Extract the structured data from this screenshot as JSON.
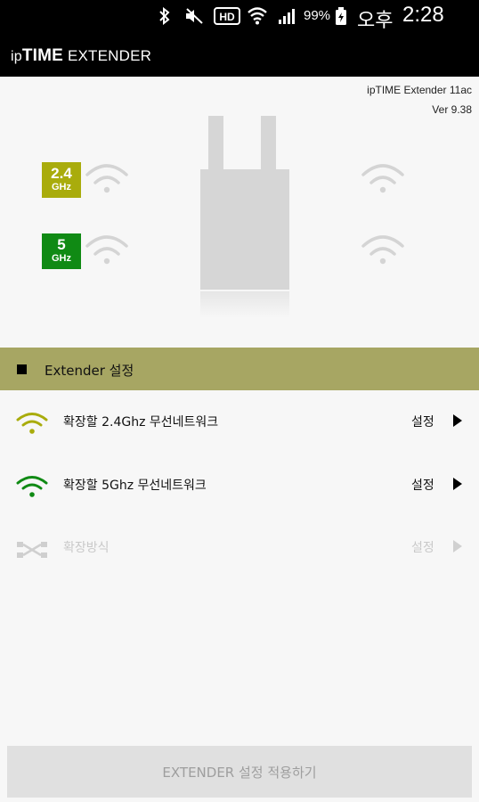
{
  "status_bar": {
    "battery_percent": "99%",
    "ampm": "오후",
    "time": "2:28",
    "icons": [
      "bluetooth-icon",
      "mute-icon",
      "hd-icon",
      "wifi-icon",
      "signal-icon",
      "battery-icon"
    ]
  },
  "app_bar": {
    "title_ip": "ip",
    "title_time": "TIME",
    "title_extender": " EXTENDER"
  },
  "device": {
    "model": "ipTIME Extender 11ac",
    "version": "Ver 9.38",
    "band_24": {
      "num": "2.4",
      "unit": "GHz",
      "color": "#a9ac0c"
    },
    "band_5": {
      "num": "5",
      "unit": "GHz",
      "color": "#108a14"
    }
  },
  "settings": {
    "section_title": "Extender 설정",
    "items": [
      {
        "label": "확장할 2.4Ghz 무선네트워크",
        "action": "설정",
        "icon": "wifi-24-icon",
        "color": "#a9ac0c",
        "enabled": true
      },
      {
        "label": "확장할 5Ghz 무선네트워크",
        "action": "설정",
        "icon": "wifi-5-icon",
        "color": "#108a14",
        "enabled": true
      },
      {
        "label": "확장방식",
        "action": "설정",
        "icon": "shuffle-icon",
        "color": "#cfcfcf",
        "enabled": false
      }
    ]
  },
  "apply_button_label": "EXTENDER 설정 적용하기"
}
